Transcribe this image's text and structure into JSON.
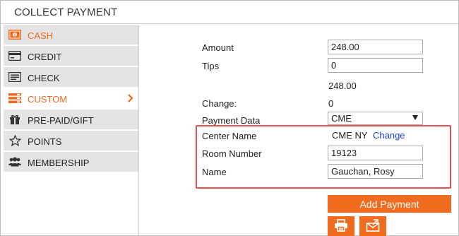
{
  "header": {
    "title": "COLLECT PAYMENT"
  },
  "sidebar": {
    "items": [
      {
        "label": "CASH",
        "icon": "cash-icon"
      },
      {
        "label": "CREDIT",
        "icon": "credit-card-icon"
      },
      {
        "label": "CHECK",
        "icon": "check-icon"
      },
      {
        "label": "CUSTOM",
        "icon": "custom-icon"
      },
      {
        "label": "PRE-PAID/GIFT",
        "icon": "gift-icon"
      },
      {
        "label": "POINTS",
        "icon": "star-icon"
      },
      {
        "label": "MEMBERSHIP",
        "icon": "users-icon"
      }
    ],
    "active": "CUSTOM"
  },
  "form": {
    "amount_label": "Amount",
    "amount_value": "248.00",
    "tips_label": "Tips",
    "tips_value": "0",
    "total_value": "248.00",
    "change_label": "Change:",
    "change_value": "0",
    "payment_data_label": "Payment Data",
    "payment_data_selected": "CME",
    "center_name_label": "Center Name",
    "center_name_value": "CME NY",
    "center_change_link": "Change",
    "room_number_label": "Room Number",
    "room_number_value": "19123",
    "name_label": "Name",
    "name_value": "Gauchan, Rosy"
  },
  "actions": {
    "add_payment_label": "Add Payment",
    "print_icon": "print-icon",
    "email_icon": "export-icon"
  },
  "colors": {
    "accent": "#f06b1d",
    "highlight_border": "#e25050",
    "link": "#1a3fd0",
    "sidebar_bg": "#e4e4e4"
  }
}
